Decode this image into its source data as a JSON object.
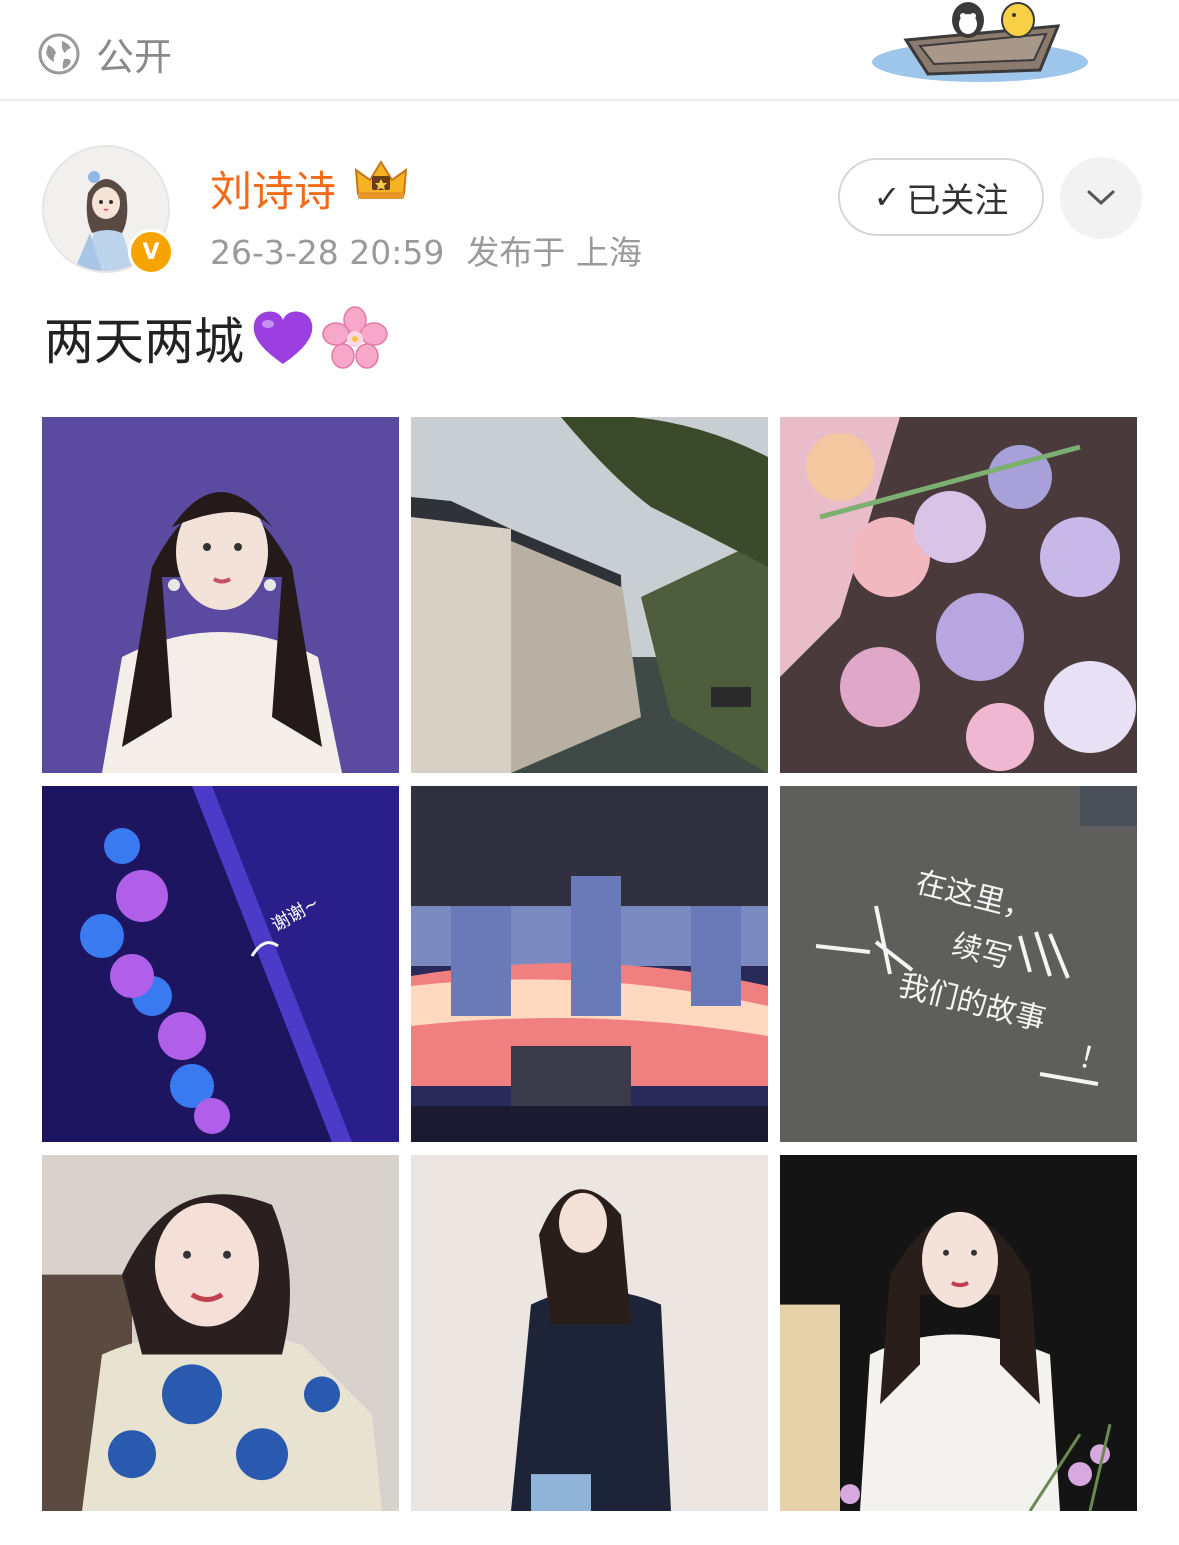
{
  "visibility": {
    "label": "公开",
    "icon": "globe-icon"
  },
  "author": {
    "name": "刘诗诗",
    "badge": "V",
    "vip_icon": "crown-icon"
  },
  "meta": {
    "date": "26-3-28 20:59",
    "location": "发布于 上海"
  },
  "follow_button": {
    "check": "✓",
    "label": "已关注"
  },
  "more_button": {
    "icon": "chevron-down-icon"
  },
  "content": {
    "text": "两天两城",
    "emoji": [
      "purple-heart",
      "cherry-blossom"
    ]
  },
  "photos": [
    {
      "name": "portrait-white-blouse"
    },
    {
      "name": "canal-town"
    },
    {
      "name": "flower-bouquet"
    },
    {
      "name": "blue-hair-ornament",
      "caption": "谢谢~"
    },
    {
      "name": "stage-set"
    },
    {
      "name": "chalk-wall-message",
      "lines": [
        "在这里，",
        "续写",
        "我们的故事",
        "！"
      ]
    },
    {
      "name": "portrait-embroidered-dress"
    },
    {
      "name": "portrait-navy-blazer"
    },
    {
      "name": "portrait-lace-top"
    }
  ],
  "colors": {
    "name": "#f26b19",
    "meta": "#9a9a9a",
    "badge": "#f7a400"
  }
}
